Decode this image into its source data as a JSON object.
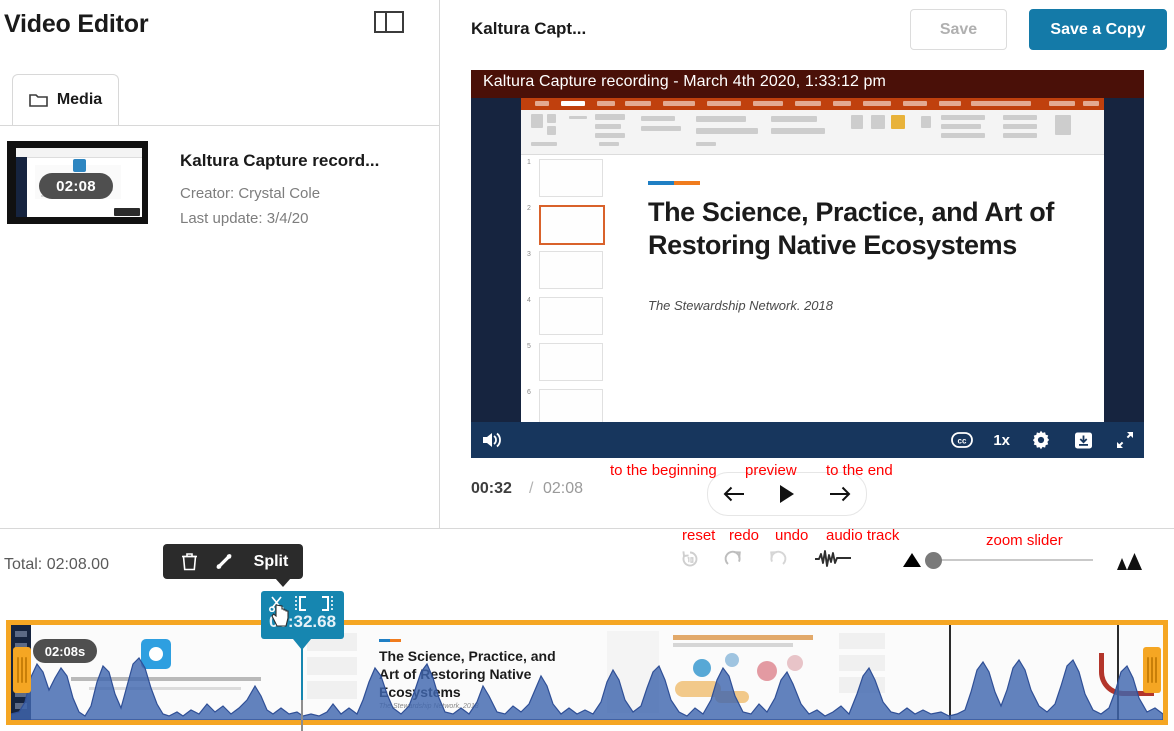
{
  "app": {
    "title": "Video Editor",
    "layout_toggle_icon": "panel-layout-icon"
  },
  "media_panel": {
    "tab": {
      "label": "Media",
      "icon": "folder-icon"
    },
    "item": {
      "name": "Kaltura Capture record...",
      "creator": "Creator: Crystal Cole",
      "last_update": "Last update: 3/4/20",
      "duration_badge": "02:08"
    }
  },
  "editor_header": {
    "title": "Kaltura Capt...",
    "save_label": "Save",
    "save_copy_label": "Save a Copy"
  },
  "player": {
    "recording_title": "Kaltura Capture recording - March 4th 2020, 1:33:12 pm",
    "slide": {
      "title": "The Science, Practice, and Art of Restoring Native Ecosystems",
      "subtitle": "The Stewardship Network. 2018",
      "thumbnail_numbers": [
        "1",
        "2",
        "3",
        "4",
        "5",
        "6"
      ],
      "selected_thumbnail": "2"
    },
    "controls": {
      "volume_icon": "volume-icon",
      "captions_icon": "closed-captions-icon",
      "speed_label": "1x",
      "settings_icon": "gear-icon",
      "download_icon": "download-icon",
      "fullscreen_icon": "fullscreen-icon"
    },
    "time": {
      "current": "00:32",
      "separator": "/",
      "total": "02:08"
    },
    "transport": {
      "to_beginning_icon": "arrow-left-icon",
      "play_icon": "play-icon",
      "to_end_icon": "arrow-right-icon"
    }
  },
  "annotations": {
    "to_the_beginning": "to the beginning",
    "preview": "preview",
    "to_the_end": "to the end",
    "reset": "reset",
    "redo": "redo",
    "undo": "undo",
    "audio_track": "audio track",
    "zoom_slider": "zoom slider"
  },
  "timeline_toolbar": {
    "total_label": "Total: 02:08.00",
    "context_menu": {
      "delete_icon": "trash-icon",
      "fade_icon": "fade-icon",
      "split_label": "Split"
    },
    "reset_icon": "reset-icon",
    "redo_icon": "redo-icon",
    "undo_icon": "undo-icon",
    "audio_track_icon": "audio-waveform-icon",
    "zoom_out_icon": "small-triangle-icon",
    "zoom_in_icon": "large-triangles-icon"
  },
  "timeline": {
    "duration_badge": "02:08s",
    "playhead": {
      "time": "00:32.68",
      "split_icon": "scissors-icon",
      "trim_start_icon": "bracket-left-icon",
      "trim_end_icon": "bracket-right-icon"
    },
    "left_handle_icon": "trim-handle-left",
    "right_handle_icon": "trim-handle-right"
  },
  "colors": {
    "accent_blue": "#147aa8",
    "timeline_orange": "#f5a623",
    "playhead_blue": "#1686b0",
    "annotation_red": "#ff0000",
    "player_bar": "#17365d"
  }
}
